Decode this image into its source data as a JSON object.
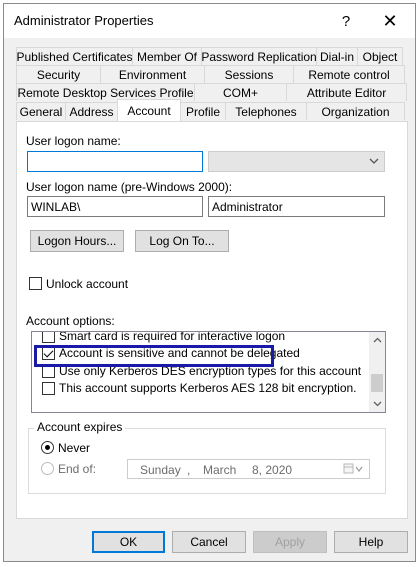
{
  "window": {
    "title": "Administrator Properties",
    "help_glyph": "?",
    "close_glyph": "✕"
  },
  "tabs": {
    "row1": [
      "Published Certificates",
      "Member Of",
      "Password Replication",
      "Dial-in",
      "Object"
    ],
    "row2": [
      "Security",
      "Environment",
      "Sessions",
      "Remote control"
    ],
    "row3": [
      "Remote Desktop Services Profile",
      "COM+",
      "Attribute Editor"
    ],
    "row4": [
      "General",
      "Address",
      "Account",
      "Profile",
      "Telephones",
      "Organization"
    ],
    "active": "Account"
  },
  "account": {
    "logon_name_label": "User logon name:",
    "logon_name_value": "",
    "upn_suffix_value": "",
    "pre2000_label": "User logon name (pre-Windows 2000):",
    "domain_value": "WINLAB\\",
    "pre2000_value": "Administrator",
    "logon_hours_button": "Logon Hours...",
    "log_on_to_button": "Log On To...",
    "unlock_label": "Unlock account",
    "unlock_checked": false,
    "account_options_label": "Account options:",
    "options": [
      {
        "label": "Smart card is required for interactive logon",
        "checked": false
      },
      {
        "label": "Account is sensitive and cannot be delegated",
        "checked": true
      },
      {
        "label": "Use only Kerberos DES encryption types for this account",
        "checked": false
      },
      {
        "label": "This account supports Kerberos AES 128 bit encryption.",
        "checked": false
      }
    ],
    "account_expires_label": "Account expires",
    "never_label": "Never",
    "never_selected": true,
    "end_of_label": "End of:",
    "end_of_date": {
      "weekday": "Sunday",
      "sep": ",",
      "month": "March",
      "day_year": "8, 2020"
    }
  },
  "footer": {
    "ok": "OK",
    "cancel": "Cancel",
    "apply": "Apply",
    "help": "Help"
  },
  "colors": {
    "focus_blue": "#0078d7",
    "highlight_box": "#1a1aa8"
  }
}
